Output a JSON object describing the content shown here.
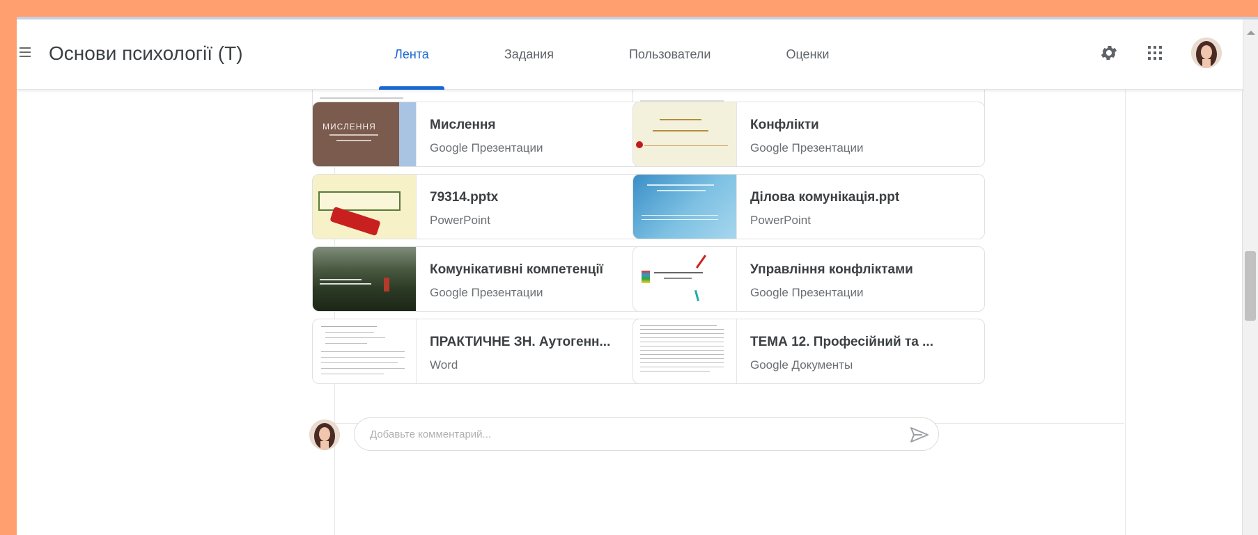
{
  "app": {
    "title": "Основи психології (Т)"
  },
  "tabs": [
    {
      "label": "Лента",
      "active": true
    },
    {
      "label": "Задания",
      "active": false
    },
    {
      "label": "Пользователи",
      "active": false
    },
    {
      "label": "Оценки",
      "active": false
    }
  ],
  "toolbar": {
    "settings_icon": "gear-icon",
    "apps_icon": "apps-grid-icon",
    "avatar_icon": "user-avatar"
  },
  "materials": [
    {
      "title": "Мислення",
      "type": "Google Презентации",
      "thumb_text": "МИСЛЕННЯ"
    },
    {
      "title": "Конфлікти",
      "type": "Google Презентации"
    },
    {
      "title": "79314.pptx",
      "type": "PowerPoint"
    },
    {
      "title": "Ділова комунікація.ppt",
      "type": "PowerPoint"
    },
    {
      "title": "Комунікативні компетенції",
      "type": "Google Презентации"
    },
    {
      "title": "Управління конфліктами",
      "type": "Google Презентации"
    },
    {
      "title": "ПРАКТИЧНЕ ЗН. Аутогенн...",
      "type": "Word"
    },
    {
      "title": "ТЕМА 12. Професійний та ...",
      "type": "Google Документы"
    }
  ],
  "comment": {
    "placeholder": "Добавьте комментарий...",
    "send_icon": "send-icon"
  },
  "colors": {
    "accent": "#1967d2",
    "frame": "#FF9E6E"
  }
}
